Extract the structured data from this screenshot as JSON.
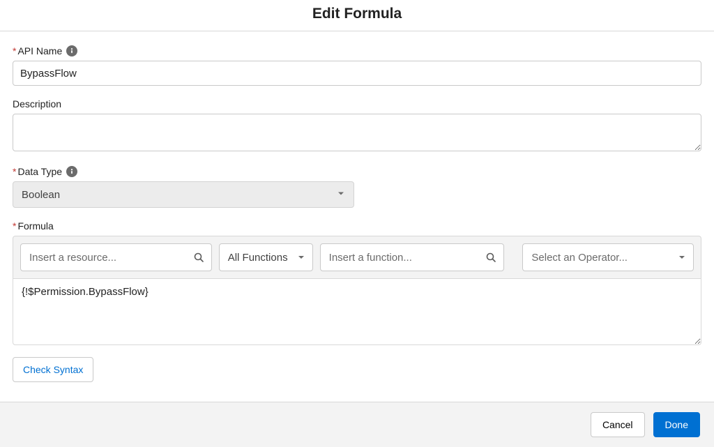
{
  "modal": {
    "title": "Edit Formula"
  },
  "fields": {
    "api_name": {
      "label": "API Name",
      "value": "BypassFlow"
    },
    "description": {
      "label": "Description",
      "value": ""
    },
    "data_type": {
      "label": "Data Type",
      "value": "Boolean"
    },
    "formula": {
      "label": "Formula",
      "resource_placeholder": "Insert a resource...",
      "all_functions_label": "All Functions",
      "function_placeholder": "Insert a function...",
      "operator_placeholder": "Select an Operator...",
      "body": "{!$Permission.BypassFlow}"
    }
  },
  "buttons": {
    "check_syntax": "Check Syntax",
    "cancel": "Cancel",
    "done": "Done"
  }
}
